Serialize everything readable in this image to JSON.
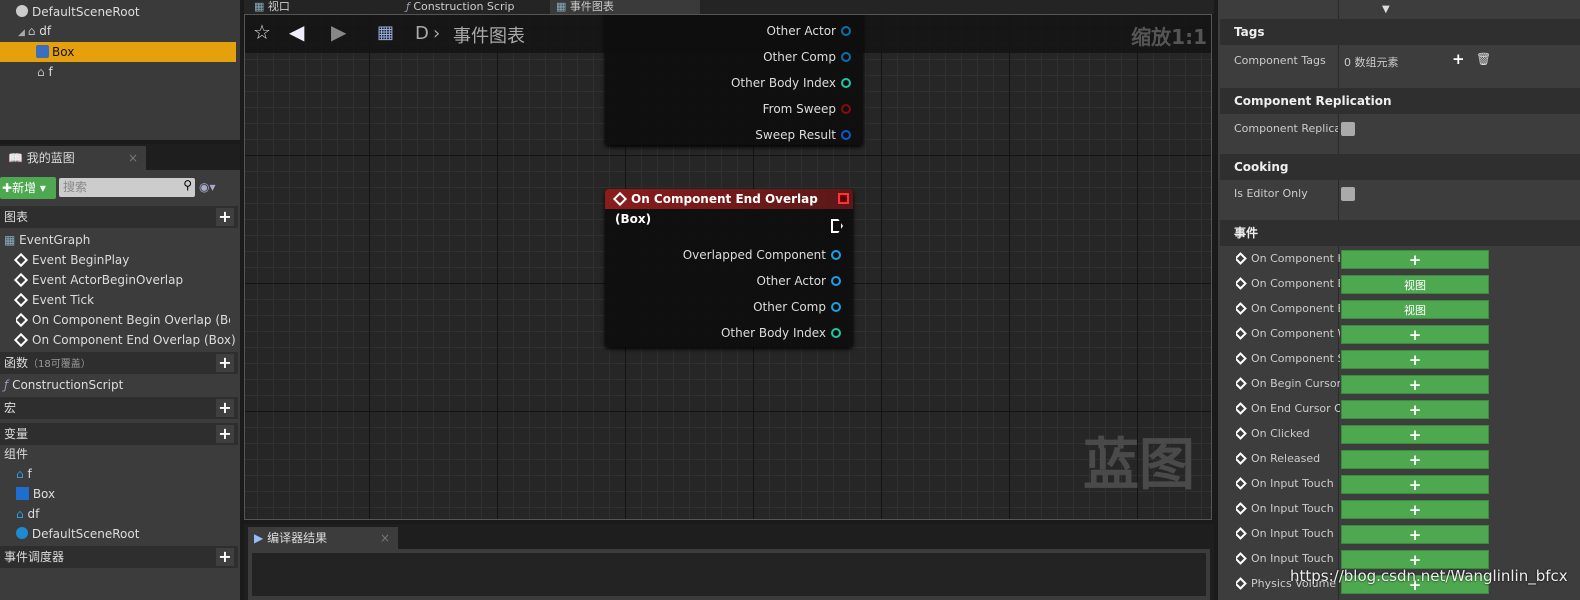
{
  "tree": {
    "items": [
      {
        "label": "DefaultSceneRoot"
      },
      {
        "label": "df"
      },
      {
        "label": "Box"
      },
      {
        "label": "f"
      }
    ]
  },
  "tabs": {
    "viewport": "视口",
    "construction": "Construction Scrip",
    "event_graph": "事件图表"
  },
  "my_blueprint": {
    "title": "我的蓝图",
    "add_label": "新增",
    "search_placeholder": "搜索",
    "sections": {
      "graphs": "图表",
      "functions": "函数",
      "functions_count": "（18可覆盖）",
      "macros": "宏",
      "variables": "变量",
      "components": "组件",
      "dispatchers": "事件调度器"
    },
    "graph_items": [
      "EventGraph",
      "Event BeginPlay",
      "Event ActorBeginOverlap",
      "Event Tick",
      "On Component Begin Overlap (Box)",
      "On Component End Overlap (Box)"
    ],
    "function_items": [
      "ConstructionScript"
    ],
    "component_items": [
      "f",
      "Box",
      "df",
      "DefaultSceneRoot"
    ]
  },
  "graph": {
    "breadcrumb_root": "D",
    "breadcrumb_current": "事件图表",
    "zoom": "缩放1:1",
    "watermark": "蓝图",
    "node1_pins": [
      {
        "label": "Other Actor",
        "color": "#0a6ea8"
      },
      {
        "label": "Other Comp",
        "color": "#0a6ea8"
      },
      {
        "label": "Other Body Index",
        "color": "#1fc7a0"
      },
      {
        "label": "From Sweep",
        "color": "#8c0a0a"
      },
      {
        "label": "Sweep Result",
        "color": "#0a5cc8"
      }
    ],
    "node2": {
      "title": "On Component End Overlap (Box)",
      "header_color": "#8a1c1c",
      "pins": [
        {
          "label": "Overlapped Component",
          "color": "#1aa0e6"
        },
        {
          "label": "Other Actor",
          "color": "#1aa0e6"
        },
        {
          "label": "Other Comp",
          "color": "#1aa0e6"
        },
        {
          "label": "Other Body Index",
          "color": "#1fc7a0"
        }
      ]
    }
  },
  "compiler": {
    "title": "编译器结果"
  },
  "details": {
    "tags": {
      "title": "Tags",
      "label": "Component Tags",
      "value": "0 数组元素"
    },
    "replication": {
      "title": "Component Replication",
      "label": "Component Replicate"
    },
    "cooking": {
      "title": "Cooking",
      "label": "Is Editor Only"
    },
    "events": {
      "title": "事件",
      "items": [
        {
          "label": "On Component H",
          "button": "+"
        },
        {
          "label": "On Component E",
          "button": "视图"
        },
        {
          "label": "On Component E",
          "button": "视图"
        },
        {
          "label": "On Component W",
          "button": "+"
        },
        {
          "label": "On Component S",
          "button": "+"
        },
        {
          "label": "On Begin Cursor",
          "button": "+"
        },
        {
          "label": "On End Cursor O",
          "button": "+"
        },
        {
          "label": "On Clicked",
          "button": "+"
        },
        {
          "label": "On Released",
          "button": "+"
        },
        {
          "label": "On Input Touch",
          "button": "+"
        },
        {
          "label": "On Input Touch",
          "button": "+"
        },
        {
          "label": "On Input Touch",
          "button": "+"
        },
        {
          "label": "On Input Touch",
          "button": "+"
        },
        {
          "label": "Physics Volume",
          "button": "+"
        }
      ]
    }
  },
  "watermark": "https://blog.csdn.net/Wanglinlin_bfcx",
  "colors": {
    "selection": "#e5a10c",
    "green_button": "#4ea84f"
  }
}
